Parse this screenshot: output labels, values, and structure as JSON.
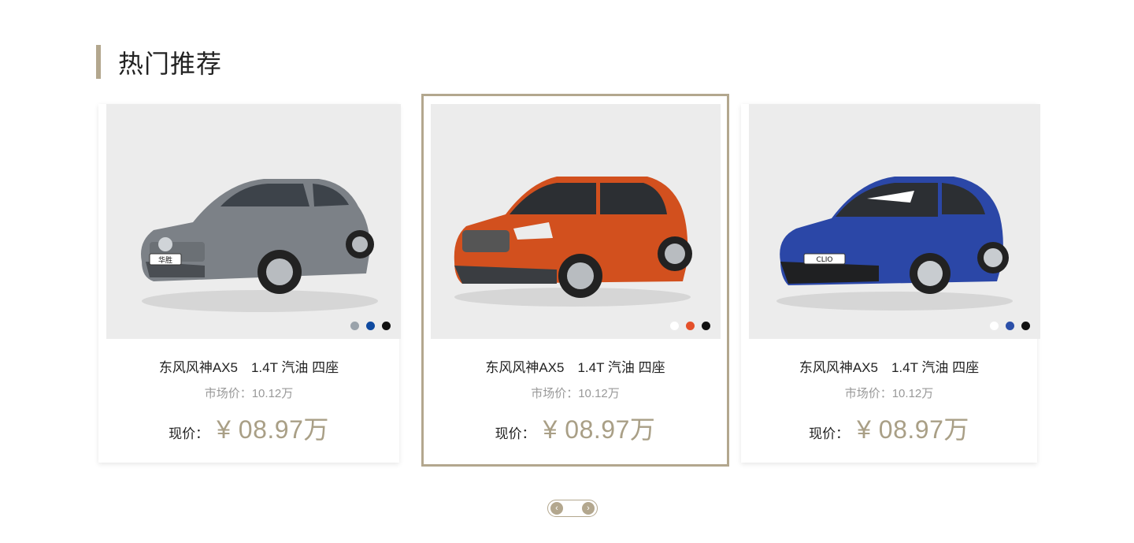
{
  "section": {
    "title": "热门推荐"
  },
  "cards": [
    {
      "name": "东风风神AX5　1.4T 汽油 四座",
      "market_price": "市场价：10.12万",
      "current_label": "现价：",
      "current_price": "¥ 08.97万",
      "plate_text": "华胜",
      "body_color": "#7c8187",
      "swatches": [
        "#9aa3ab",
        "#0f4aa0",
        "#111111"
      ]
    },
    {
      "name": "东风风神AX5　1.4T 汽油 四座",
      "market_price": "市场价：10.12万",
      "current_label": "现价：",
      "current_price": "¥ 08.97万",
      "plate_text": "",
      "body_color": "#d2501e",
      "swatches": [
        "#ffffff",
        "#e4502a",
        "#111111"
      ]
    },
    {
      "name": "东风风神AX5　1.4T 汽油 四座",
      "market_price": "市场价：10.12万",
      "current_label": "现价：",
      "current_price": "¥ 08.97万",
      "plate_text": "CLIO",
      "body_color": "#2b47a7",
      "swatches": [
        "#ffffff",
        "#2b4fa8",
        "#111111"
      ]
    }
  ],
  "pager": {
    "prev_icon": "chevron-left-icon",
    "next_icon": "chevron-right-icon",
    "prev_glyph": "‹",
    "next_glyph": "›"
  },
  "colors": {
    "accent": "#b3a78e",
    "price": "#a99f86",
    "image_bg": "#ececec"
  }
}
